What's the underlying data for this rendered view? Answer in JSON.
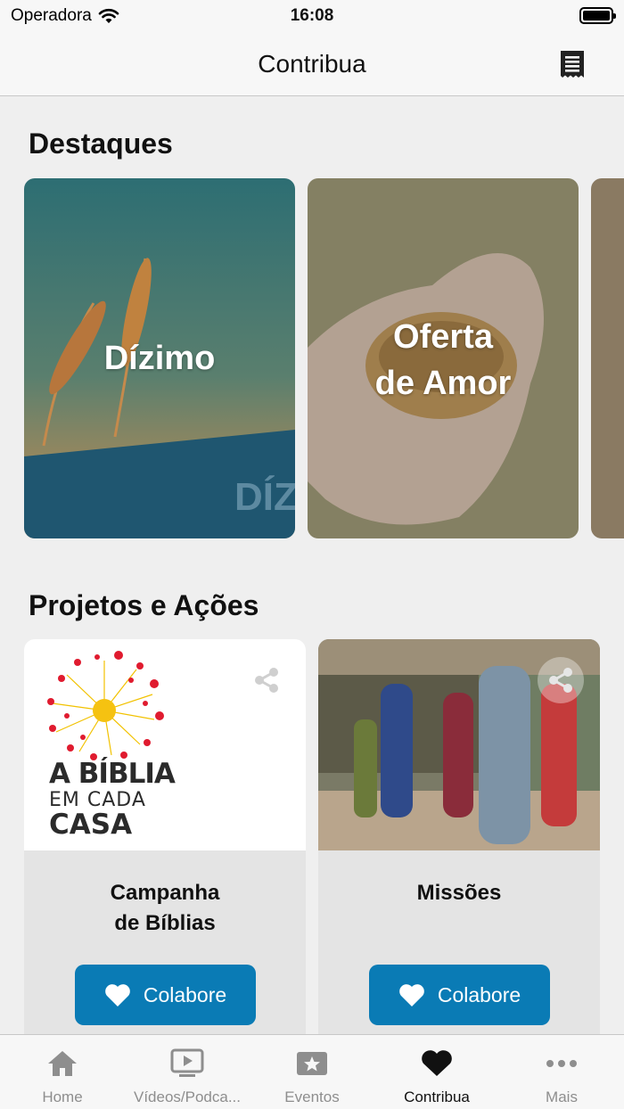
{
  "status_bar": {
    "carrier": "Operadora",
    "time": "16:08"
  },
  "header": {
    "title": "Contribua"
  },
  "highlights": {
    "title": "Destaques",
    "cards": [
      {
        "label": "Dízimo",
        "watermark": "DÍZI"
      },
      {
        "label_line1": "Oferta",
        "label_line2": "de Amor"
      }
    ]
  },
  "projects": {
    "title": "Projetos e Ações",
    "cards": [
      {
        "title_line1": "Campanha",
        "title_line2": "de Bíblias",
        "button_label": "Colabore",
        "logo_line1": "A BÍBLIA",
        "logo_line2": "EM CADA",
        "logo_line3": "CASA"
      },
      {
        "title_line1": "Missões",
        "button_label": "Colabore"
      }
    ]
  },
  "tab_bar": {
    "tabs": [
      {
        "label": "Home",
        "icon": "home-icon"
      },
      {
        "label": "Vídeos/Podca...",
        "icon": "video-icon"
      },
      {
        "label": "Eventos",
        "icon": "star-ticket-icon"
      },
      {
        "label": "Contribua",
        "icon": "heart-icon",
        "active": true
      },
      {
        "label": "Mais",
        "icon": "more-icon"
      }
    ]
  },
  "colors": {
    "accent": "#0a7bb5",
    "tab_inactive": "#8e8e8e",
    "tab_active": "#111111"
  }
}
